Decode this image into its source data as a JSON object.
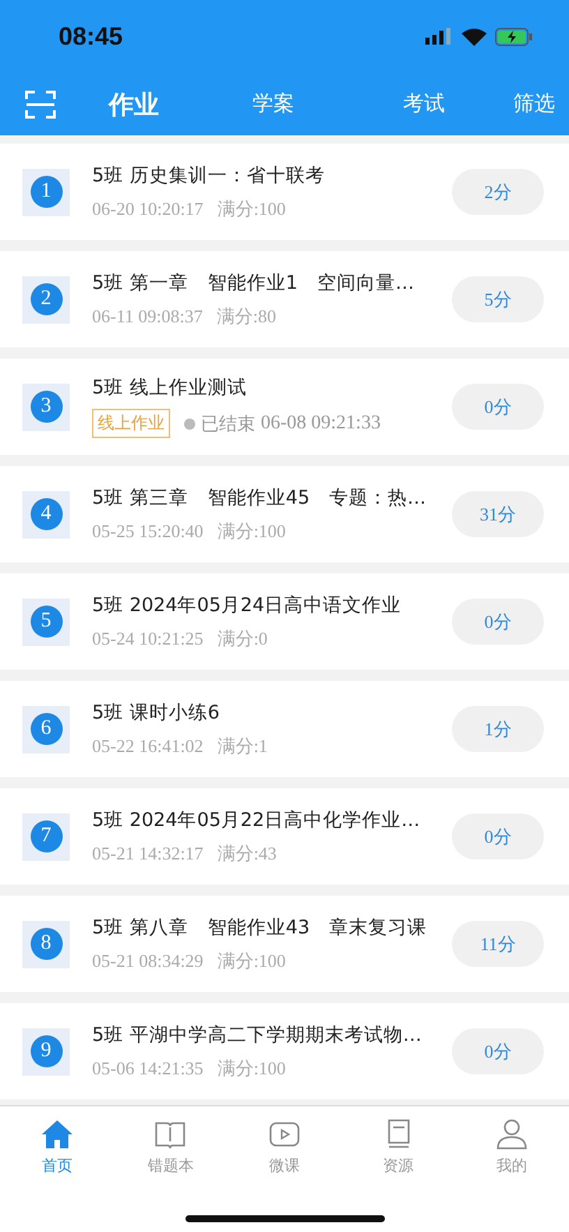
{
  "status_bar": {
    "time": "08:45"
  },
  "tabs": [
    {
      "label": "作业",
      "selected": true
    },
    {
      "label": "学案",
      "selected": false
    },
    {
      "label": "考试",
      "selected": false
    }
  ],
  "filter": "筛选",
  "assignments": [
    {
      "kind": "normal",
      "index": "1",
      "title": "5班 历史集训一：省十联考",
      "time": "06-20 10:20:17",
      "full_score": "满分:100",
      "score": "2分"
    },
    {
      "kind": "normal",
      "index": "2",
      "title": "5班 第一章　智能作业1　空间向量…",
      "time": "06-11 09:08:37",
      "full_score": "满分:80",
      "score": "5分"
    },
    {
      "kind": "online",
      "index": "3",
      "title": "5班 线上作业测试",
      "tag": "线上作业",
      "status": "已结束",
      "time": "06-08 09:21:33",
      "score": "0分"
    },
    {
      "kind": "normal",
      "index": "4",
      "title": "5班 第三章　智能作业45　专题：热…",
      "time": "05-25 15:20:40",
      "full_score": "满分:100",
      "score": "31分"
    },
    {
      "kind": "normal",
      "index": "5",
      "title": "5班 2024年05月24日高中语文作业",
      "time": "05-24 10:21:25",
      "full_score": "满分:0",
      "score": "0分"
    },
    {
      "kind": "normal",
      "index": "6",
      "title": "5班 课时小练6",
      "time": "05-22 16:41:02",
      "full_score": "满分:1",
      "score": "1分"
    },
    {
      "kind": "normal",
      "index": "7",
      "title": "5班 2024年05月22日高中化学作业…",
      "time": "05-21 14:32:17",
      "full_score": "满分:43",
      "score": "0分"
    },
    {
      "kind": "normal",
      "index": "8",
      "title": "5班 第八章　智能作业43　章末复习课",
      "time": "05-21 08:34:29",
      "full_score": "满分:100",
      "score": "11分"
    },
    {
      "kind": "normal",
      "index": "9",
      "title": "5班 平湖中学高二下学期期末考试物…",
      "time": "05-06 14:21:35",
      "full_score": "满分:100",
      "score": "0分"
    }
  ],
  "bottom_nav": [
    {
      "label": "首页",
      "selected": true
    },
    {
      "label": "错题本",
      "selected": false
    },
    {
      "label": "微课",
      "selected": false
    },
    {
      "label": "资源",
      "selected": false
    },
    {
      "label": "我的",
      "selected": false
    }
  ]
}
